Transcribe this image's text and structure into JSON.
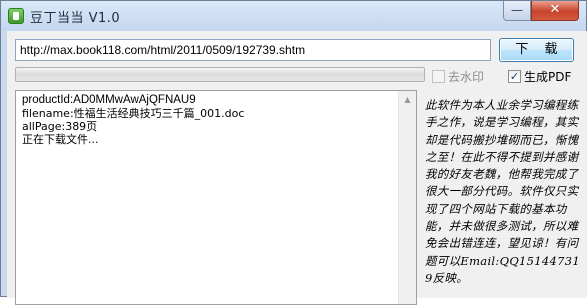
{
  "window": {
    "title": "豆丁当当  V1.0",
    "minimize_icon": "minimize-icon",
    "minimize_glyph": "—",
    "close_icon": "close-icon",
    "close_glyph": "✕",
    "app_icon": "app-icon"
  },
  "toolbar": {
    "url_value": "http://max.book118.com/html/2011/0509/192739.shtm",
    "download_label": "下 载"
  },
  "progress": {
    "value": 0.0,
    "color": "#37c81c"
  },
  "options": {
    "watermark_label": "去水印",
    "watermark_checked": false,
    "watermark_enabled": false,
    "pdf_label": "生成PDF",
    "pdf_checked": true,
    "pdf_check_glyph": "✓"
  },
  "log": {
    "lines": [
      "productId:AD0MMwAwAjQFNAU9",
      "filename:性福生活经典技巧三千篇_001.doc",
      "allPage:389页",
      "正在下载文件..."
    ],
    "scroll_up_glyph": "▲"
  },
  "about": {
    "text": "此软件为本人业余学习编程练手之作，说是学习编程，其实却是代码搬抄堆砌而已，惭愧之至！在此不得不提到并感谢我的好友老魏，他帮我完成了很大一部分代码。软件仅只实现了四个网站下载的基本功能，并未做很多测试，所以难免会出错连连，望见谅！有问题可以Email:QQ151447319反映。"
  }
}
